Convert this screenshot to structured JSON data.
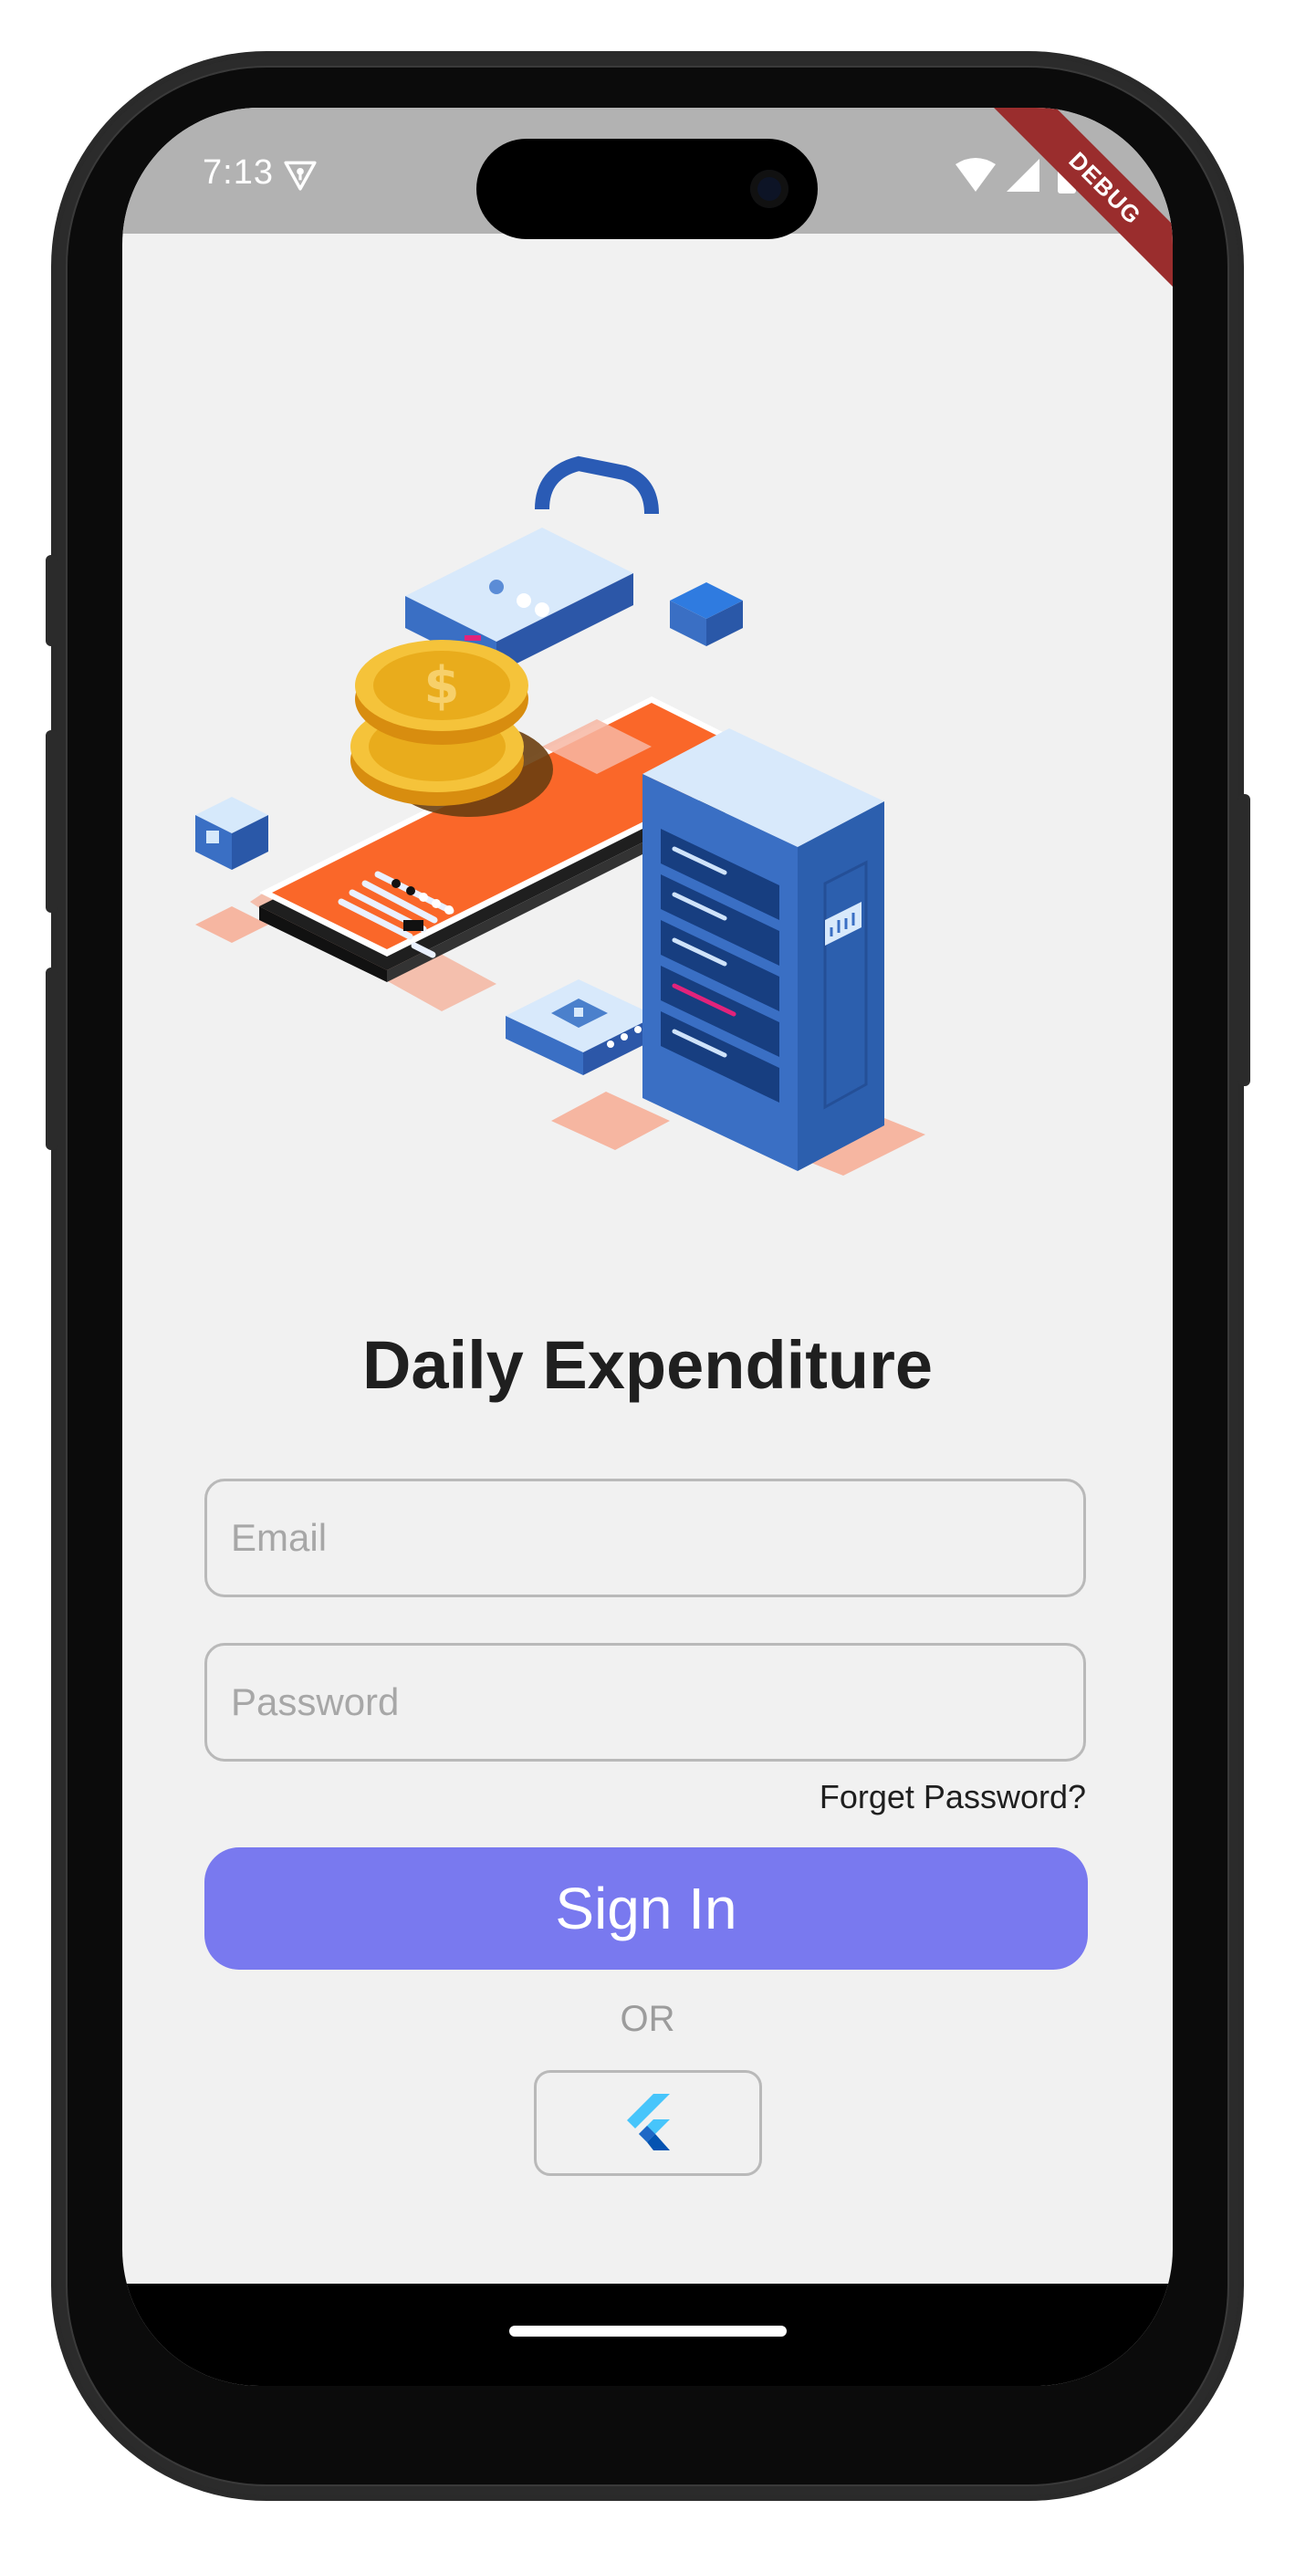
{
  "status_bar": {
    "time": "7:13",
    "debug_label": "DEBUG",
    "icons": [
      "vpn-key-icon",
      "wifi-icon",
      "signal-icon",
      "battery-icon"
    ]
  },
  "app": {
    "title": "Daily Expenditure",
    "email_placeholder": "Email",
    "password_placeholder": "Password",
    "forgot_label": "Forget Password?",
    "signin_label": "Sign In",
    "or_label": "OR",
    "social_icon": "flutter-logo-icon"
  },
  "colors": {
    "accent": "#7979ef",
    "background": "#f1f1f1",
    "status_bar": "#b2b2b2",
    "debug": "#9a2d2d"
  }
}
